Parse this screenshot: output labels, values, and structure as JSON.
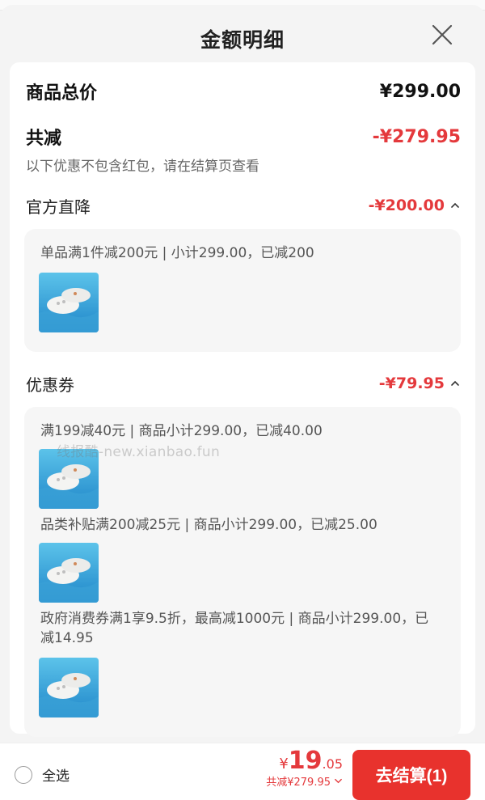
{
  "sheet": {
    "title": "金额明细",
    "close_icon": "close-icon"
  },
  "summary": {
    "total_label": "商品总价",
    "total_value": "¥299.00",
    "discount_label": "共减",
    "discount_value": "-¥279.95",
    "hint": "以下优惠不包含红包，请在结算页查看"
  },
  "sections": [
    {
      "label": "官方直降",
      "value": "-¥200.00",
      "items": [
        {
          "rule": "单品满1件减200元 | 小计299.00，已减200"
        }
      ]
    },
    {
      "label": "优惠券",
      "value": "-¥79.95",
      "items": [
        {
          "rule": "满199减40元 | 商品小计299.00，已减40.00"
        },
        {
          "rule": "品类补贴满200减25元 | 商品小计299.00，已减25.00"
        },
        {
          "rule_line1": "政府消费券满1享9.5折，最高减1000元 | 商品小计299.00，已",
          "rule_line2": "减14.95"
        }
      ]
    }
  ],
  "watermark": "线报酷-new.xianbao.fun",
  "bottom": {
    "select_all": "全选",
    "currency": "¥",
    "price_int": "19",
    "price_dec": ".05",
    "saved": "共减¥279.95",
    "checkout": "去结算(1)"
  },
  "colors": {
    "accent": "#e4393c",
    "button": "#e8322d",
    "thumb_blue": "#3aa6d8"
  }
}
